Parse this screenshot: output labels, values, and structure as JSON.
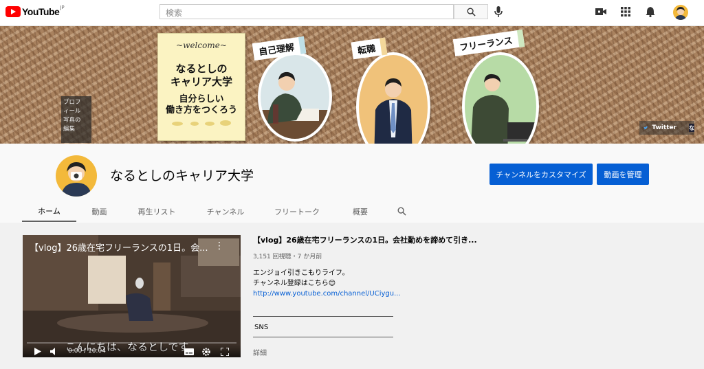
{
  "header": {
    "logo_text": "YouTube",
    "country_code": "JP",
    "search_placeholder": "検索"
  },
  "banner": {
    "welcome": "~welcome~",
    "title_line1": "なるとしの",
    "title_line2": "キャリア大学",
    "subtitle_line1": "自分らしい",
    "subtitle_line2": "働き方をつくろう",
    "tags": [
      "自己理解",
      "転職",
      "フリーランス"
    ],
    "profile_edit": [
      "プロフ",
      "ィール",
      "写真の",
      "編集"
    ],
    "twitter_label": "Twitter"
  },
  "channel": {
    "name": "なるとしのキャリア大学",
    "customize_button": "チャンネルをカスタマイズ",
    "manage_button": "動画を管理",
    "tabs": [
      "ホーム",
      "動画",
      "再生リスト",
      "チャンネル",
      "フリートーク",
      "概要"
    ]
  },
  "featured": {
    "player_title": "【vlog】26歳在宅フリーランスの1日。会...",
    "title": "【vlog】26歳在宅フリーランスの1日。会社勤めを諦めて引き...",
    "meta": "3,151 回視聴・7 か月前",
    "desc_line1": "エンジョイ引きこもりライフ。",
    "desc_line2": "チャンネル登録はこちら😊",
    "link": "http://www.youtube.com/channel/UCiygu...",
    "sns": "SNS",
    "more": "詳細",
    "subtitle": "こんにちは、なるとしです",
    "time": "0:00 / 10:04"
  },
  "colors": {
    "brand_red": "#ff0000",
    "primary_blue": "#065fd4"
  }
}
